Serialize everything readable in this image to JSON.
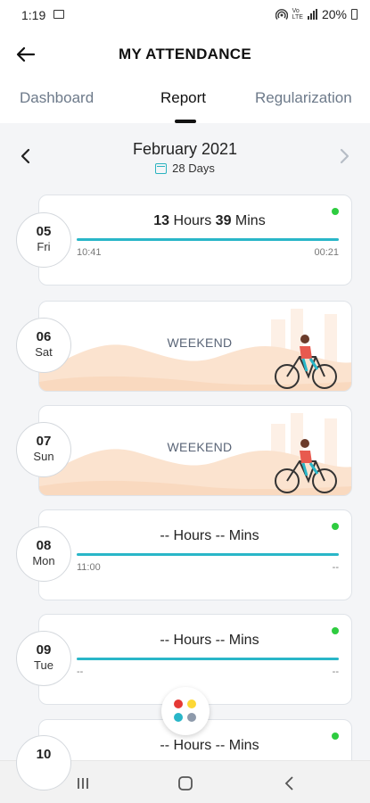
{
  "status_bar": {
    "time": "1:19",
    "battery": "20%",
    "icons": [
      "image-icon",
      "hotspot-icon",
      "volte-icon",
      "signal-icon",
      "battery-icon"
    ]
  },
  "header": {
    "title": "MY ATTENDANCE",
    "back_icon": "arrow-left-icon"
  },
  "tabs": [
    {
      "label": "Dashboard",
      "active": false
    },
    {
      "label": "Report",
      "active": true
    },
    {
      "label": "Regularization",
      "active": false
    }
  ],
  "month_nav": {
    "month": "February 2021",
    "days": "28 Days",
    "prev_icon": "chevron-left-icon",
    "next_icon": "chevron-right-icon"
  },
  "days": [
    {
      "date": "05",
      "dow": "Fri",
      "type": "worked",
      "hours": "13",
      "mins": "39",
      "hours_label": "Hours",
      "mins_label": "Mins",
      "in_time": "10:41",
      "out_time": "00:21",
      "status_dot": true
    },
    {
      "date": "06",
      "dow": "Sat",
      "type": "weekend",
      "label": "WEEKEND"
    },
    {
      "date": "07",
      "dow": "Sun",
      "type": "weekend",
      "label": "WEEKEND"
    },
    {
      "date": "08",
      "dow": "Mon",
      "type": "worked",
      "hours": "--",
      "mins": "--",
      "hours_label": "Hours",
      "mins_label": "Mins",
      "in_time": "11:00",
      "out_time": "--",
      "status_dot": true
    },
    {
      "date": "09",
      "dow": "Tue",
      "type": "worked",
      "hours": "--",
      "mins": "--",
      "hours_label": "Hours",
      "mins_label": "Mins",
      "in_time": "--",
      "out_time": "--",
      "status_dot": true
    },
    {
      "date": "10",
      "dow": "",
      "type": "worked",
      "hours": "--",
      "mins": "--",
      "hours_label": "Hours",
      "mins_label": "Mins",
      "in_time": "",
      "out_time": "",
      "status_dot": true
    }
  ],
  "fab": {
    "icon": "apps-dots-icon",
    "colors": [
      "#e53935",
      "#fdd835",
      "#29b6c8",
      "#8e9aab"
    ]
  },
  "colors": {
    "accent": "#29b6c8",
    "status_green": "#2ecc40",
    "weekend_art": "#fbe3cf"
  },
  "nav_bar": {
    "icons": [
      "recents-icon",
      "home-icon",
      "back-icon"
    ]
  }
}
